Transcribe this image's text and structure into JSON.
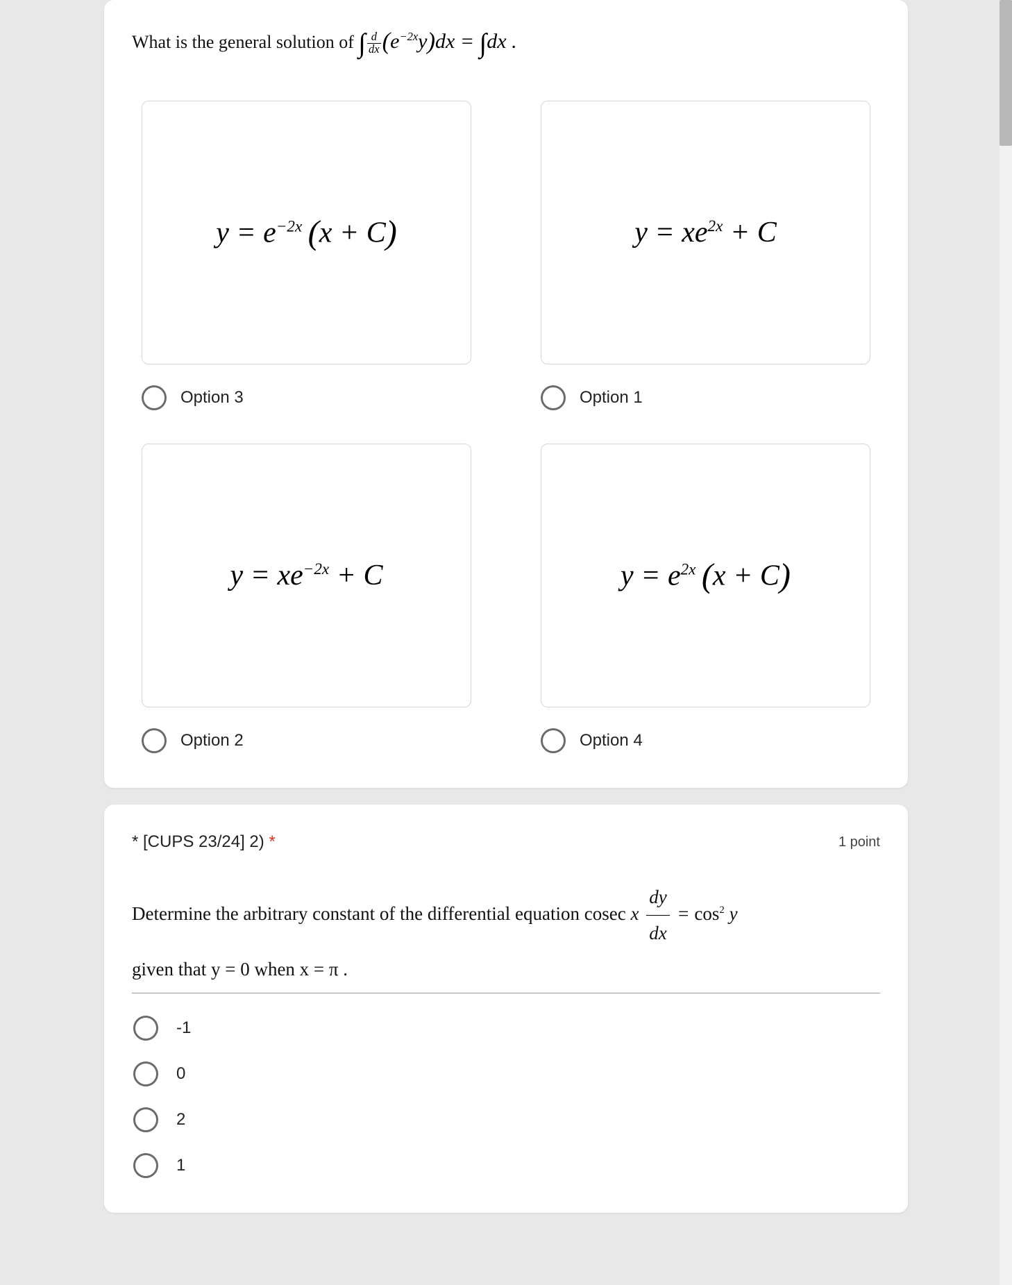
{
  "q1": {
    "prompt_prefix": "What is the general solution of ",
    "options": {
      "a": {
        "label": "Option 3"
      },
      "b": {
        "label": "Option 1"
      },
      "c": {
        "label": "Option 2"
      },
      "d": {
        "label": "Option 4"
      }
    }
  },
  "q2": {
    "title": "* [CUPS 23/24] 2) ",
    "required_mark": "*",
    "points": "1 point",
    "body_part1": "Determine the arbitrary constant of the differential equation  cosec ",
    "body_part2": " given that  y = 0 when x = π .",
    "answers": [
      "-1",
      "0",
      "2",
      "1"
    ]
  }
}
